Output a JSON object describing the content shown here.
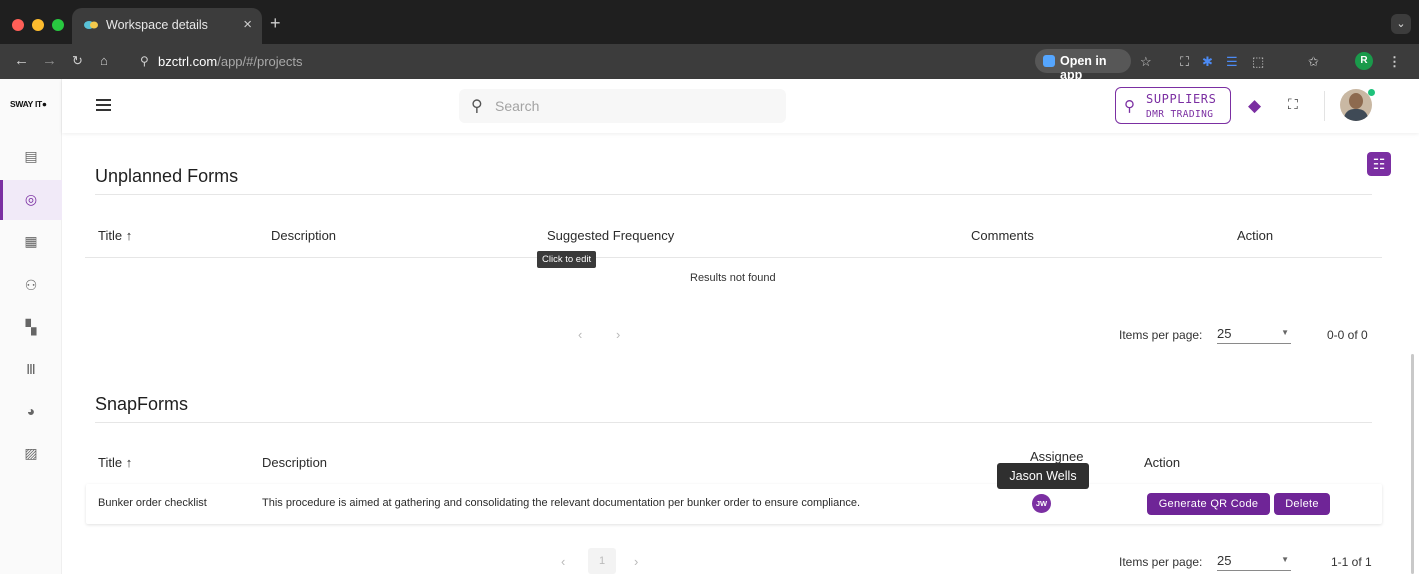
{
  "browser": {
    "tab_title": "Workspace details",
    "tab_close": "×",
    "new_tab": "+",
    "tab_menu": "⌄",
    "url_host": "bzctrl.com",
    "url_path": "/app/#/projects",
    "open_in_app": "Open in app",
    "profile_initial": "R"
  },
  "sidebar": {
    "logo": "SWAY IT",
    "items": [
      {
        "icon": "clipboard-icon"
      },
      {
        "icon": "target-icon",
        "active": true
      },
      {
        "icon": "document-stack-icon"
      },
      {
        "icon": "users-icon"
      },
      {
        "icon": "dashboard-icon"
      },
      {
        "icon": "library-icon"
      },
      {
        "icon": "palette-icon"
      },
      {
        "icon": "form-settings-icon"
      }
    ]
  },
  "topbar": {
    "search_placeholder": "Search",
    "supplier_line1": "SUPPLIERS",
    "supplier_line2": "DMR TRADING"
  },
  "unplanned": {
    "title": "Unplanned Forms",
    "columns": {
      "title": "Title",
      "sort_arrow": "↑",
      "description": "Description",
      "frequency": "Suggested Frequency",
      "comments": "Comments",
      "action": "Action"
    },
    "tooltip": "Click to edit",
    "empty": "Results not found",
    "pager_prev": "‹",
    "pager_next": "›",
    "items_per_page_label": "Items per page:",
    "items_per_page": "25",
    "range": "0-0 of 0"
  },
  "snapforms": {
    "title": "SnapForms",
    "columns": {
      "title": "Title",
      "sort_arrow": "↑",
      "description": "Description",
      "assignee": "Assignee",
      "action": "Action"
    },
    "rows": [
      {
        "title": "Bunker order checklist",
        "description": "This procedure is aimed at gathering and consolidating the relevant documentation per bunker order to ensure compliance.",
        "assignee_initials": "JW",
        "generate_qr": "Generate QR Code",
        "delete": "Delete"
      }
    ],
    "assignee_tooltip": "Jason Wells",
    "pager_prev": "‹",
    "page": "1",
    "pager_next": "›",
    "items_per_page_label": "Items per page:",
    "items_per_page": "25",
    "range": "1-1 of 1"
  },
  "colors": {
    "accent": "#7b2fa2",
    "button": "#6f2597",
    "chrome_dark": "#1f1f1f"
  }
}
